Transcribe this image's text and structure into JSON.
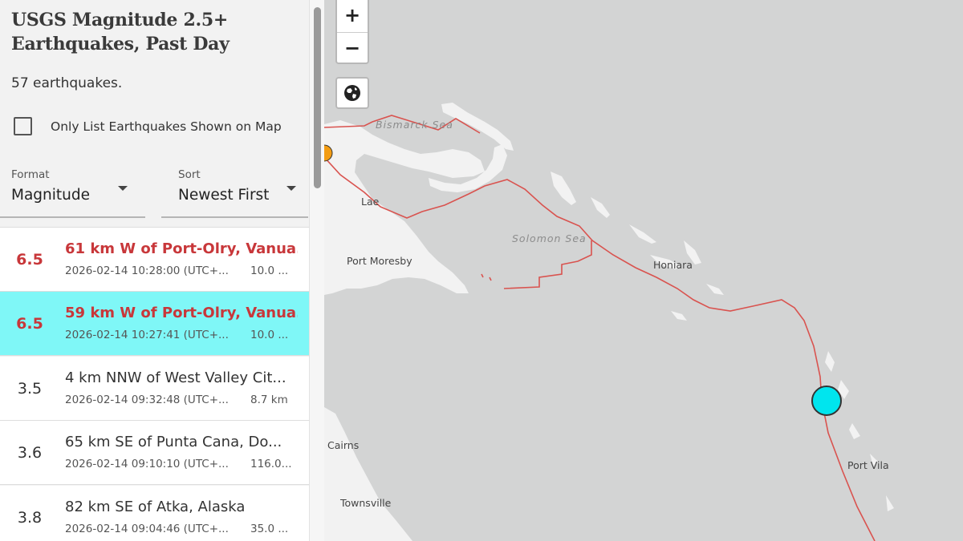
{
  "sidebar": {
    "title": "USGS Magnitude 2.5+ Earthquakes, Past Day",
    "count_text": "57 earthquakes.",
    "only_list_label": "Only List Earthquakes Shown on Map",
    "format": {
      "label": "Format",
      "value": "Magnitude"
    },
    "sort": {
      "label": "Sort",
      "value": "Newest First"
    }
  },
  "quakes": [
    {
      "mag": "6.5",
      "place": "61 km W of Port-Olry, Vanua...",
      "time": "2026-02-14 10:28:00 (UTC+...",
      "depth": "10.0 ..."
    },
    {
      "mag": "6.5",
      "place": "59 km W of Port-Olry, Vanua...",
      "time": "2026-02-14 10:27:41 (UTC+...",
      "depth": "10.0 ..."
    },
    {
      "mag": "3.5",
      "place": "4 km NNW of West Valley Cit...",
      "time": "2026-02-14 09:32:48 (UTC+...",
      "depth": "8.7 km"
    },
    {
      "mag": "3.6",
      "place": "65 km SE of Punta Cana, Do...",
      "time": "2026-02-14 09:10:10 (UTC+...",
      "depth": "116.0..."
    },
    {
      "mag": "3.8",
      "place": "82 km SE of Atka, Alaska",
      "time": "2026-02-14 09:04:46 (UTC+...",
      "depth": "35.0 ..."
    }
  ],
  "map": {
    "zoom_in": "+",
    "zoom_out": "−",
    "labels": {
      "bismarck": "Bismarck Sea",
      "solomon": "Solomon Sea",
      "lae": "Lae",
      "port_moresby": "Port Moresby",
      "honiara": "Honiara",
      "cairns": "Cairns",
      "townsville": "Townsville",
      "port_vila": "Port Vila"
    },
    "colors": {
      "land": "#f2f2f2",
      "water": "#d3d4d4",
      "plate_boundary": "#d9534f",
      "selected_marker": "#00e5ee",
      "other_marker": "#f39c12"
    }
  }
}
